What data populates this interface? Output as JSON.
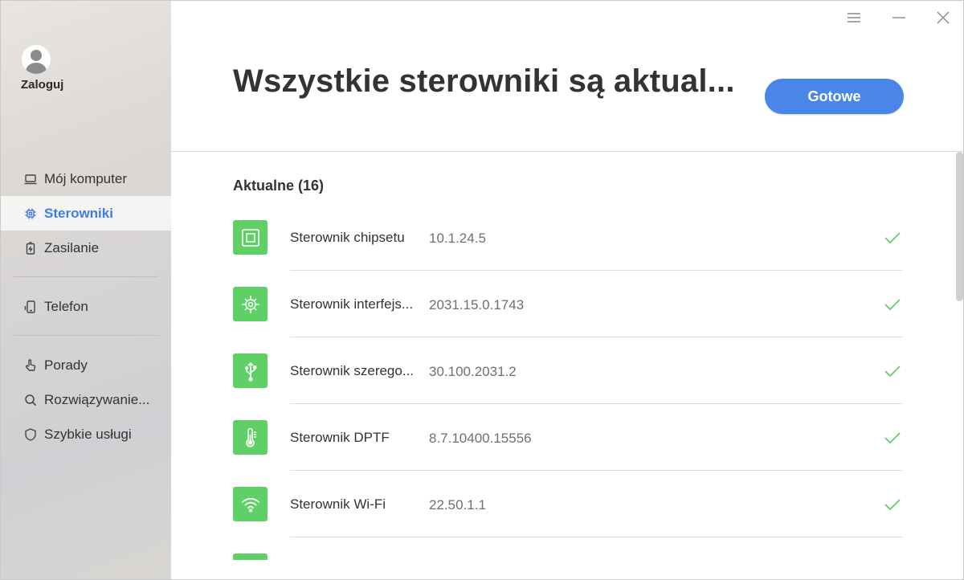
{
  "sidebar": {
    "login_label": "Zaloguj",
    "items": [
      {
        "label": "Mój komputer",
        "icon": "laptop-icon",
        "active": false
      },
      {
        "label": "Sterowniki",
        "icon": "chip-icon",
        "active": true
      },
      {
        "label": "Zasilanie",
        "icon": "battery-icon",
        "active": false
      },
      {
        "label": "Telefon",
        "icon": "phone-icon",
        "active": false
      },
      {
        "label": "Porady",
        "icon": "hand-pointer-icon",
        "active": false
      },
      {
        "label": "Rozwiązywanie...",
        "icon": "search-icon",
        "active": false
      },
      {
        "label": "Szybkie usługi",
        "icon": "shield-icon",
        "active": false
      }
    ]
  },
  "header": {
    "title": "Wszystkie sterowniki są aktual...",
    "done_label": "Gotowe"
  },
  "section": {
    "title": "Aktualne (16)"
  },
  "drivers": [
    {
      "name": "Sterownik chipsetu",
      "version": "10.1.24.5",
      "icon": "chipset-icon"
    },
    {
      "name": "Sterownik interfejs...",
      "version": "2031.15.0.1743",
      "icon": "interface-chip-icon"
    },
    {
      "name": "Sterownik szerego...",
      "version": "30.100.2031.2",
      "icon": "usb-icon"
    },
    {
      "name": "Sterownik DPTF",
      "version": "8.7.10400.15556",
      "icon": "thermometer-icon"
    },
    {
      "name": "Sterownik Wi-Fi",
      "version": "22.50.1.1",
      "icon": "wifi-icon"
    }
  ],
  "colors": {
    "accent": "#4a86e8",
    "active_nav": "#3f7de6",
    "driver_icon_bg": "#5fd065",
    "check": "#5fd065"
  }
}
